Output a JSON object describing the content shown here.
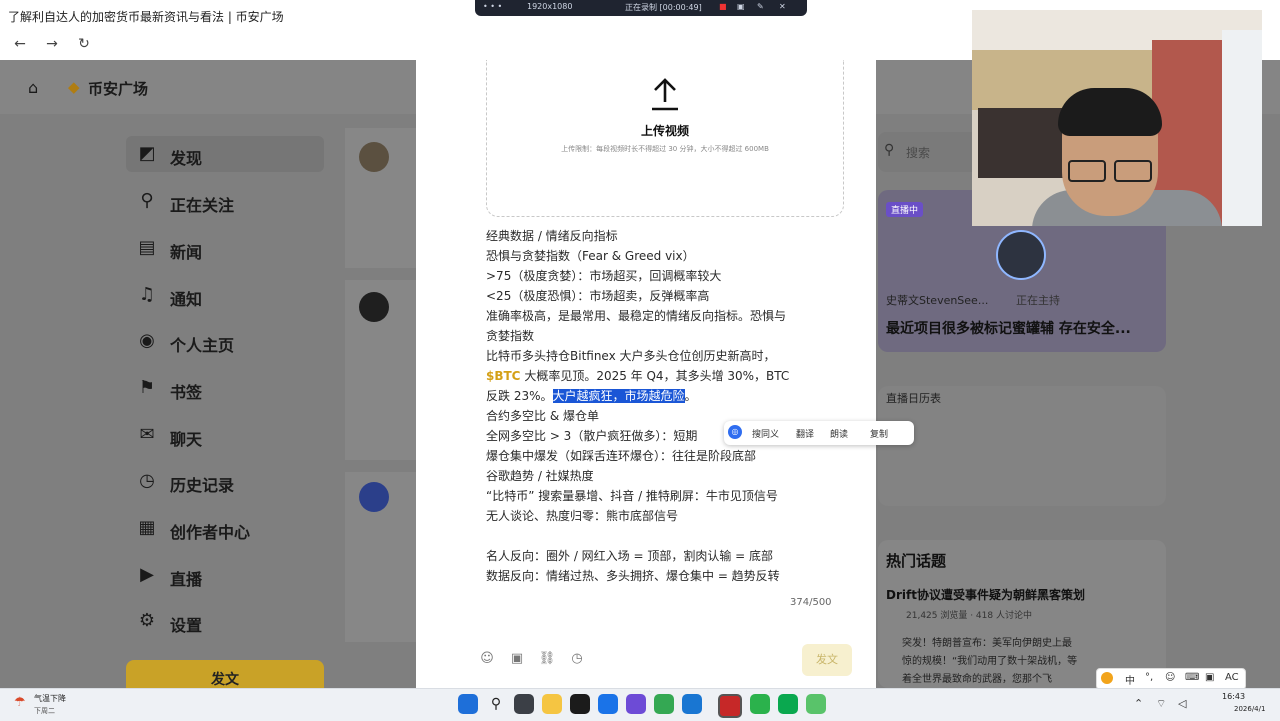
{
  "browser": {
    "tab_title": "了解利自达人的加密货币最新资讯与看法 | 币安广场"
  },
  "recording_bar": {
    "resolution": "1920x1080",
    "status": "正在录制 [00:00:49]"
  },
  "square": {
    "logo_text": "币安广场",
    "nav": [
      {
        "label": "发现",
        "icon": "discover-icon"
      },
      {
        "label": "正在关注",
        "icon": "following-icon"
      },
      {
        "label": "新闻",
        "icon": "news-icon"
      },
      {
        "label": "通知",
        "icon": "bell-icon"
      },
      {
        "label": "个人主页",
        "icon": "profile-icon"
      },
      {
        "label": "书签",
        "icon": "bookmark-icon"
      },
      {
        "label": "聊天",
        "icon": "chat-icon"
      },
      {
        "label": "历史记录",
        "icon": "history-icon"
      },
      {
        "label": "创作者中心",
        "icon": "creator-icon"
      },
      {
        "label": "直播",
        "icon": "live-icon"
      },
      {
        "label": "设置",
        "icon": "settings-icon"
      }
    ],
    "post_button": "发文",
    "search_placeholder": "搜索",
    "live_badge": "直播中",
    "live_author": "史蒂文StevenSee...",
    "live_status": "正在主持",
    "live_title": "最近项目很多被标记蜜罐辅 存在安全...",
    "live_section": "直播日历表",
    "hot_topics_title": "热门话题",
    "hot_topic": "Drift协议遭受事件疑为朝鲜黑客策划",
    "hot_topic_stats": "21,425 浏览量 · 418 人讨论中",
    "hot_snippet_1": "突发！特朗普宣布：美军向伊朗史上最",
    "hot_snippet_2": "惊的规模！“我们动用了数十架战机，等",
    "hot_snippet_3": "着全世界最致命的武器，您那个飞"
  },
  "modal": {
    "upload_title": "上传视频",
    "upload_hint": "上传限制：每段视频时长不得超过 30 分钟，大小不得超过 600MB",
    "lines": [
      "经典数据 / 情绪反向指标",
      "恐惧与贪婪指数（Fear & Greed vix）",
      ">75（极度贪婪）：市场超买，回调概率较大",
      "<25（极度恐惧）：市场超卖，反弹概率高",
      "准确率极高，是最常用、最稳定的情绪反向指标。恐惧与",
      "贪婪指数",
      "比特币多头持仓Bitfinex 大户多头仓位创历史新高时，",
      "合约多空比 & 爆仓单",
      "全网多空比 > 3（散户疯狂做多）：短期",
      "爆仓集中爆发（如踩舌连环爆仓）：往往是阶段底部",
      "谷歌趋势 / 社媒热度",
      "“比特币” 搜索量暴增、抖音 / 推特刷屏：牛市见顶信号",
      "无人谈论、热度归零：熊市底部信号",
      "名人反向：圈外 / 网红入场 = 顶部，割肉认输 = 底部",
      "数据反向：情绪过热、多头拥挤、爆仓集中 = 趋势反转"
    ],
    "btc_tag": "$BTC",
    "line_btc_rest": " 大概率见顶。2025 年 Q4，其多头增 30%，BTC",
    "line_fall_prefix": "反跌 23%。",
    "line_highlight": "大户越疯狂，市场越危险",
    "line_highlight_end": "。",
    "counter": "374/500",
    "send": "发文"
  },
  "context_menu": [
    "搜同义",
    "翻译",
    "朗读",
    "复制"
  ],
  "ime": {
    "mode": "中",
    "label": "AC"
  },
  "tray": {
    "weather": "气温下降",
    "weather_sub": "下周二",
    "time": "16:43",
    "date": "2026/4/1"
  }
}
